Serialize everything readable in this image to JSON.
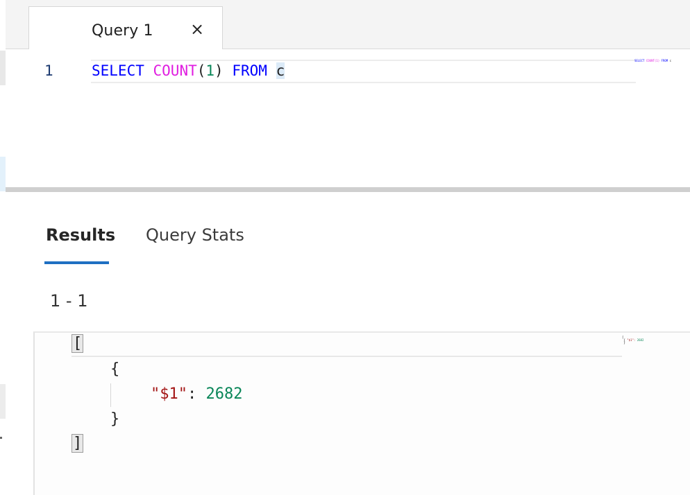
{
  "tabs": [
    {
      "label": "Query 1",
      "close_icon": "close-icon"
    }
  ],
  "editor": {
    "line_number": "1",
    "tokens": {
      "select": "SELECT",
      "count": "COUNT",
      "open_paren": "(",
      "arg": "1",
      "close_paren": ")",
      "from": "FROM",
      "container": "c"
    },
    "minimap_text": "SELECT COUNT(1) FROM c"
  },
  "results": {
    "tabs": [
      {
        "label": "Results",
        "active": true
      },
      {
        "label": "Query Stats",
        "active": false
      }
    ],
    "range": "1 - 1",
    "json": {
      "open_array": "[",
      "open_obj": "{",
      "key": "\"$1\"",
      "colon": ":",
      "value": "2682",
      "close_obj": "}",
      "close_array": "]"
    },
    "minimap_text": "\"$1\": 2682"
  },
  "colors": {
    "keyword": "#0000ff",
    "function": "#e01ee0",
    "number": "#098658",
    "json_key": "#a31515",
    "accent": "#1e6fc2"
  }
}
